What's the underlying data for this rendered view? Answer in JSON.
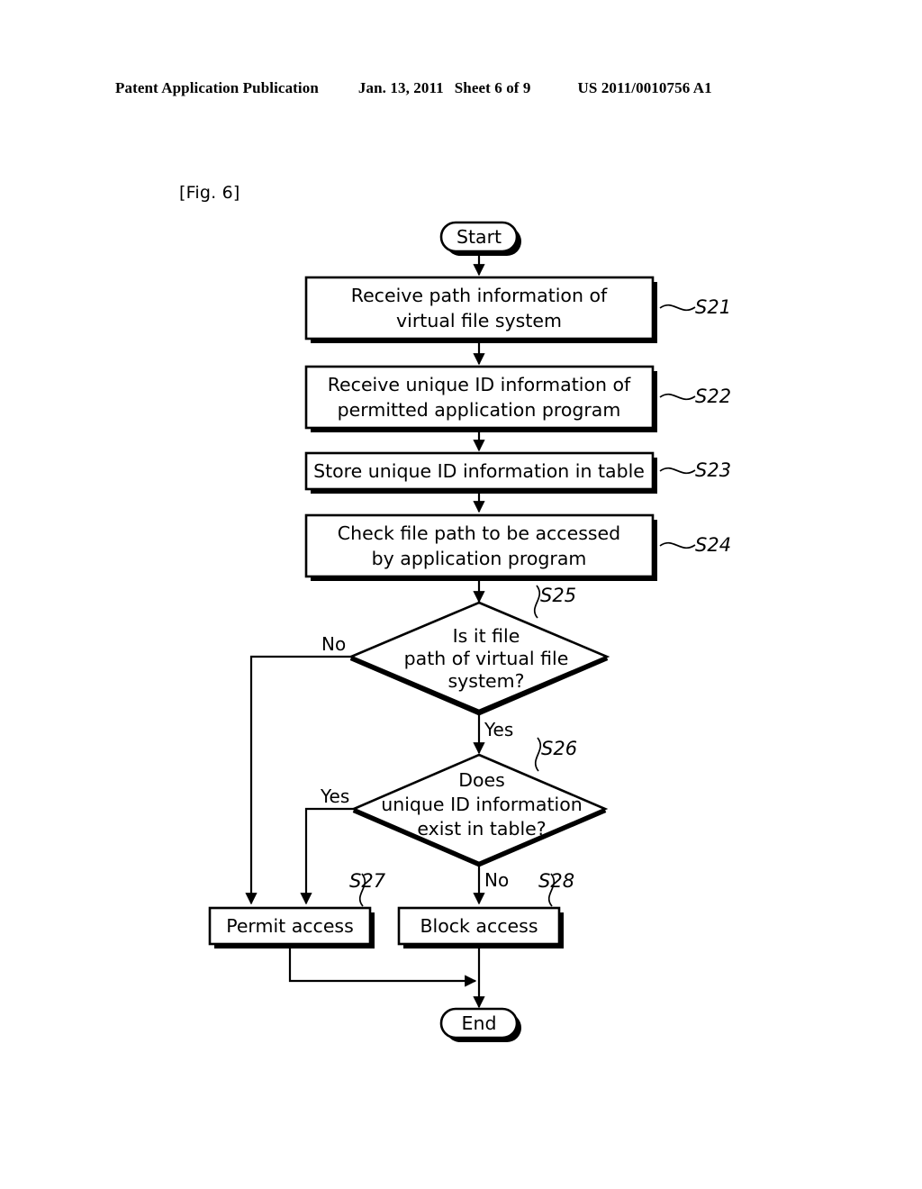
{
  "header": {
    "publication": "Patent Application Publication",
    "date": "Jan. 13, 2011",
    "sheet": "Sheet 6 of 9",
    "patent_number": "US 2011/0010756 A1"
  },
  "figure": {
    "label": "[Fig. 6]"
  },
  "flowchart": {
    "terminators": {
      "start": "Start",
      "end": "End"
    },
    "steps": [
      {
        "ref": "S21",
        "line1": "Receive path information of",
        "line2": "virtual file system"
      },
      {
        "ref": "S22",
        "line1": "Receive unique ID information of",
        "line2": "permitted application program"
      },
      {
        "ref": "S23",
        "line1": "Store unique ID information in table",
        "line2": ""
      },
      {
        "ref": "S24",
        "line1": "Check file path to be accessed",
        "line2": "by application program"
      }
    ],
    "decisions": [
      {
        "ref": "S25",
        "line1": "Is it file",
        "line2": "path of virtual file",
        "line3": "system?",
        "branch_left": "No",
        "branch_down": "Yes"
      },
      {
        "ref": "S26",
        "line1": "Does",
        "line2": "unique ID information",
        "line3": "exist in table?",
        "branch_left": "Yes",
        "branch_down": "No"
      }
    ],
    "actions": [
      {
        "ref": "S27",
        "label": "Permit access"
      },
      {
        "ref": "S28",
        "label": "Block access"
      }
    ]
  },
  "colors": {
    "ink": "#000000",
    "paper": "#ffffff"
  }
}
